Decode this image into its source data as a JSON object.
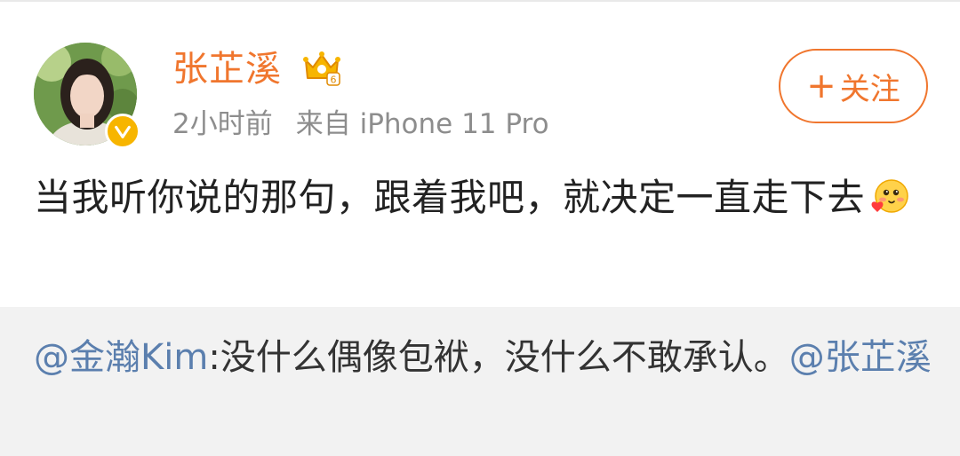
{
  "post": {
    "username": "张芷溪",
    "time": "2小时前",
    "source": "来自 iPhone 11 Pro",
    "follow_plus": "+",
    "follow_label": "关注",
    "text_main": "当我听你说的那句，跟着我吧，就决定一直走下去",
    "icons": {
      "avatar": "user-avatar",
      "verified": "verified-badge-icon",
      "crown": "crown-level-icon",
      "emoji": "blush-emoji-icon"
    }
  },
  "repost": {
    "mention_1": "@金瀚Kim",
    "text": ":没什么偶像包袱，没什么不敢承认。",
    "mention_2": "@张芷溪"
  },
  "colors": {
    "accent_orange": "#f0762e",
    "mention_blue": "#5b7fae",
    "verify_yellow": "#f7b500",
    "repost_bg": "#f2f2f2"
  }
}
